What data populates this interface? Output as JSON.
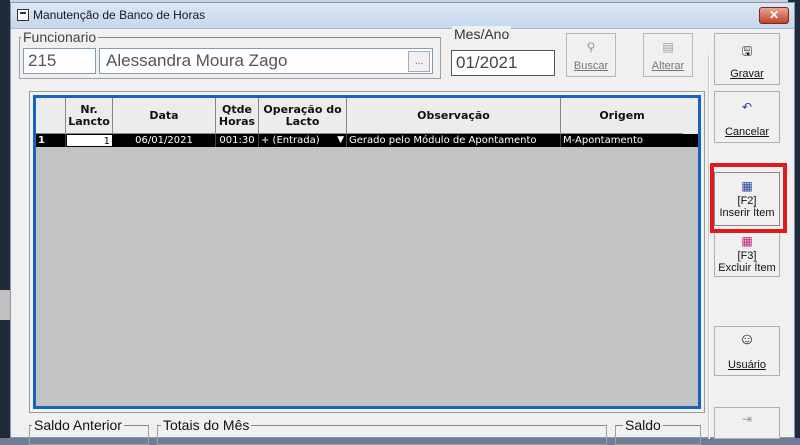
{
  "window": {
    "title": "Manutenção de Banco de Horas",
    "close_glyph": "✕"
  },
  "funcionario": {
    "legend": "Funcionario",
    "code": "215",
    "name": "Alessandra Moura Zago",
    "lookup_label": "..."
  },
  "mesano": {
    "legend": "Mes/Ano",
    "value": "01/2021"
  },
  "toolbar": {
    "buscar": "Buscar",
    "alterar": "Alterar"
  },
  "side": {
    "gravar": "Gravar",
    "cancelar": "Cancelar",
    "inserir_line1": "[F2]",
    "inserir_line2": "Inserir Ítem",
    "excluir_line1": "[F3]",
    "excluir_line2": "Excluir Ítem",
    "usuario": "Usuário"
  },
  "grid": {
    "headers": [
      "",
      "Nr. Lancto",
      "Data",
      "Qtde Horas",
      "Operação do Lacto",
      "Observação",
      "Origem"
    ],
    "rows": [
      {
        "row_no": "1",
        "nr_lancto": "1",
        "data": "06/01/2021",
        "qtde_horas": "001:30",
        "operacao": "+ (Entrada)",
        "observacao": "Gerado pelo Módulo de Apontamento",
        "origem": "M-Apontamento"
      }
    ]
  },
  "footer": {
    "saldo_anterior": "Saldo Anterior",
    "totais_mes": "Totais do Mês",
    "saldo": "Saldo"
  },
  "colors": {
    "grid_border": "#1565c0",
    "highlight": "#e01b1b",
    "selected_row_bg": "#000000"
  }
}
